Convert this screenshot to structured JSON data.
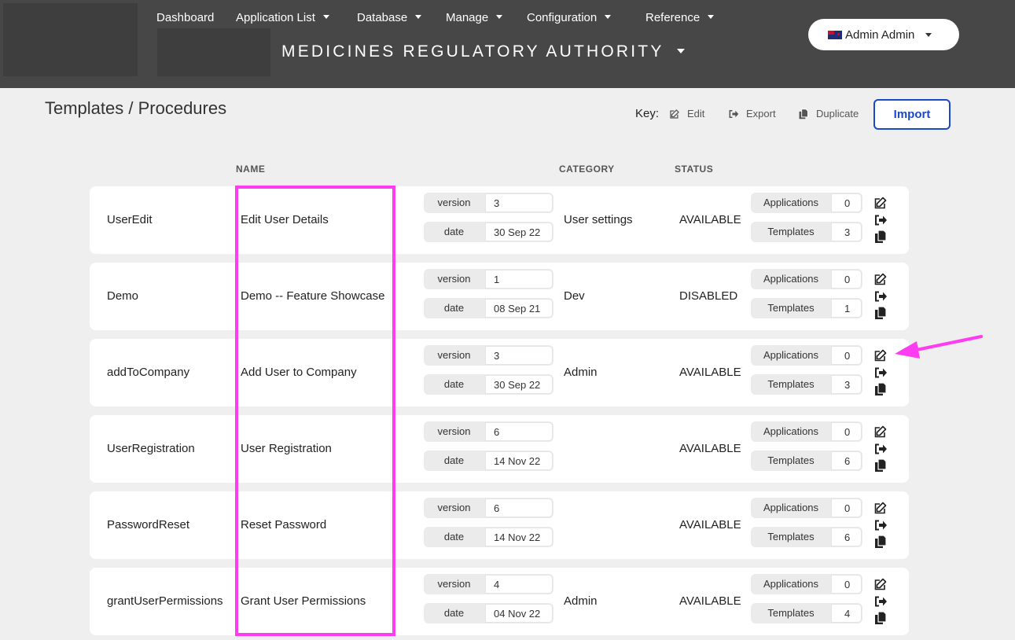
{
  "nav": {
    "items": [
      {
        "label": "Dashboard",
        "dropdown": false
      },
      {
        "label": "Application List",
        "dropdown": true
      },
      {
        "label": "Database",
        "dropdown": true
      },
      {
        "label": "Manage",
        "dropdown": true
      },
      {
        "label": "Configuration",
        "dropdown": true
      },
      {
        "label": "Reference",
        "dropdown": true
      }
    ],
    "org_name": "MEDICINES REGULATORY AUTHORITY",
    "user_label": "Admin Admin",
    "user_icon": "nz-flag-icon"
  },
  "page": {
    "title": "Templates / Procedures",
    "key_label": "Key:",
    "key_edit": "Edit",
    "key_export": "Export",
    "key_duplicate": "Duplicate",
    "import_label": "Import"
  },
  "columns": {
    "name": "NAME",
    "category": "CATEGORY",
    "status": "STATUS"
  },
  "labels": {
    "version": "version",
    "date": "date",
    "applications": "Applications",
    "templates": "Templates"
  },
  "rows": [
    {
      "code": "UserEdit",
      "name": "Edit User Details",
      "version": "3",
      "date": "30 Sep 22",
      "category": "User settings",
      "status": "AVAILABLE",
      "applications": "0",
      "templates": "3"
    },
    {
      "code": "Demo",
      "name": "Demo -- Feature Showcase",
      "version": "1",
      "date": "08 Sep 21",
      "category": "Dev",
      "status": "DISABLED",
      "applications": "0",
      "templates": "1"
    },
    {
      "code": "addToCompany",
      "name": "Add User to Company",
      "version": "3",
      "date": "30 Sep 22",
      "category": "Admin",
      "status": "AVAILABLE",
      "applications": "0",
      "templates": "3"
    },
    {
      "code": "UserRegistration",
      "name": "User Registration",
      "version": "6",
      "date": "14 Nov 22",
      "category": "",
      "status": "AVAILABLE",
      "applications": "0",
      "templates": "6"
    },
    {
      "code": "PasswordReset",
      "name": "Reset Password",
      "version": "6",
      "date": "14 Nov 22",
      "category": "",
      "status": "AVAILABLE",
      "applications": "0",
      "templates": "6"
    },
    {
      "code": "grantUserPermissions",
      "name": "Grant User Permissions",
      "version": "4",
      "date": "04 Nov 22",
      "category": "Admin",
      "status": "AVAILABLE",
      "applications": "0",
      "templates": "4"
    }
  ],
  "colors": {
    "header_bg": "#474747",
    "accent_blue": "#1b48c7",
    "annotation_magenta": "#ff3cf2"
  }
}
